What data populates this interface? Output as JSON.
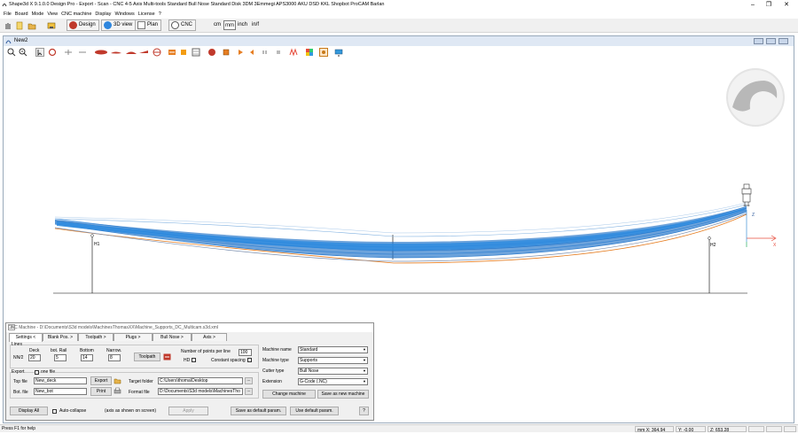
{
  "window": {
    "title": "Shape3d X 9.1.0.0 Design Pro - Export - Scan - CNC 4-5 Axis Multi-tools  Standard Bull Nose Standard Disk 3DM 3Emmegi APS3000 AKU DSD KKL Shopbot ProCAM Barlan",
    "minimize": "–",
    "maximize": "❐",
    "close": "✕"
  },
  "menu": [
    "File",
    "Board",
    "Mode",
    "View",
    "CNC machine",
    "Display",
    "Windows",
    "License",
    "?"
  ],
  "toolbar": {
    "buttons": [
      {
        "label": "Design",
        "color": "#c0392b"
      },
      {
        "label": "3D view",
        "color": "#2e86de"
      },
      {
        "label": "Plan",
        "color": "#7f8c8d"
      },
      {
        "label": "CNC",
        "color": "#555555"
      }
    ],
    "units": [
      "cm",
      "mm",
      "inch",
      "in/f"
    ],
    "selected_unit": "mm"
  },
  "document": {
    "title": "New2"
  },
  "canvas": {
    "labels": {
      "h1": "H1",
      "h2": "H2",
      "z": "Z",
      "x": "X"
    }
  },
  "dialog": {
    "title": "CNC Machine - D:\\Documents\\S3d models\\MachinesThomasXX\\Machine_Supports_DC_Multicam.s3d.xml",
    "close": "x",
    "tabs": [
      "Settings <",
      "Blank Pos. >",
      "Toolpath >",
      "Plugs >",
      "Bull Nose >",
      "Axis >"
    ],
    "lines": {
      "group_label": "Lines",
      "nn2_label": "NN/2",
      "deck_label": "Deck",
      "deck_value": "20",
      "bot_rail_label": "bot. Rail",
      "bot_rail_value": "5",
      "bottom_label": "Bottom",
      "bottom_value": "14",
      "narrow_label": "Narrow.",
      "narrow_value": "8",
      "toolpath_button": "Toolpath",
      "points_label": "Number of points per line",
      "points_value": "100",
      "hd_label": "HD",
      "constant_spacing_label": "Constant spacing"
    },
    "export": {
      "group_label": "Export",
      "one_file_label": "one file",
      "top_file_label": "Top file",
      "top_file_value": "New_deck",
      "bot_file_label": "Bot. file",
      "bot_file_value": "New_bot",
      "export_button": "Export",
      "print_button": "Print",
      "target_folder_label": "Target folder",
      "target_folder_value": "C:\\Users\\thoma\\Desktop",
      "format_file_label": "Format file",
      "format_file_value": "D:\\Documents\\S3d models\\MachinesTho",
      "browse": "..."
    },
    "machine": {
      "name_label": "Machine name",
      "name_value": "Standard",
      "type_label": "Machine type",
      "type_value": "Supports",
      "cutter_label": "Cutter type",
      "cutter_value": "Bull Nose",
      "extension_label": "Extension",
      "extension_value": "G-Code (.NC)",
      "change_button": "Change machine",
      "save_new_button": "Save as new machine"
    },
    "footer": {
      "display_all": "Display All",
      "auto_collapse": "Auto-collapse",
      "axis_note": "(axis as shown on screen)",
      "apply": "Apply",
      "save_default": "Save as default param.",
      "use_default": "Use default param.",
      "help": "?"
    }
  },
  "status": {
    "help": "Press F1 for help",
    "x": "mm  X: 364.94",
    "y": "Y: -0.00",
    "z": "Z: 653.28"
  }
}
